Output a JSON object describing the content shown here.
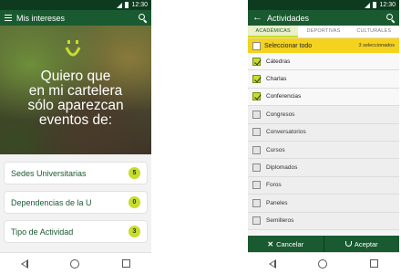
{
  "left": {
    "status_time": "12:30",
    "app_title": "Mis intereses",
    "headline": [
      "Quiero que",
      "en mi cartelera",
      "sólo aparezcan",
      "eventos de:"
    ],
    "menu": [
      {
        "label": "Sedes Universitarias",
        "count": "5"
      },
      {
        "label": "Dependencias de la U",
        "count": "0"
      },
      {
        "label": "Tipo de Actividad",
        "count": "3"
      }
    ]
  },
  "right": {
    "status_time": "12:30",
    "app_title": "Actividades",
    "tabs": [
      "ACADÉMICAS",
      "DEPORTIVAS",
      "CULTURALES"
    ],
    "active_tab": 0,
    "select_all_label": "Seleccionar todo",
    "selected_count": "3 seleccionados",
    "options": [
      {
        "label": "Cátedras",
        "checked": true
      },
      {
        "label": "Charlas",
        "checked": true
      },
      {
        "label": "Conferencias",
        "checked": true
      },
      {
        "label": "Congresos",
        "checked": false
      },
      {
        "label": "Conversatorios",
        "checked": false
      },
      {
        "label": "Cursos",
        "checked": false
      },
      {
        "label": "Diplomados",
        "checked": false
      },
      {
        "label": "Foros",
        "checked": false
      },
      {
        "label": "Paneles",
        "checked": false
      },
      {
        "label": "Semilleros",
        "checked": false
      }
    ],
    "cancel_label": "Cancelar",
    "accept_label": "Aceptar"
  },
  "colors": {
    "primary_dark": "#0e3b1f",
    "primary": "#1a5a30",
    "accent_lime": "#c8dc2c",
    "highlight_yellow": "#f5d21e"
  }
}
